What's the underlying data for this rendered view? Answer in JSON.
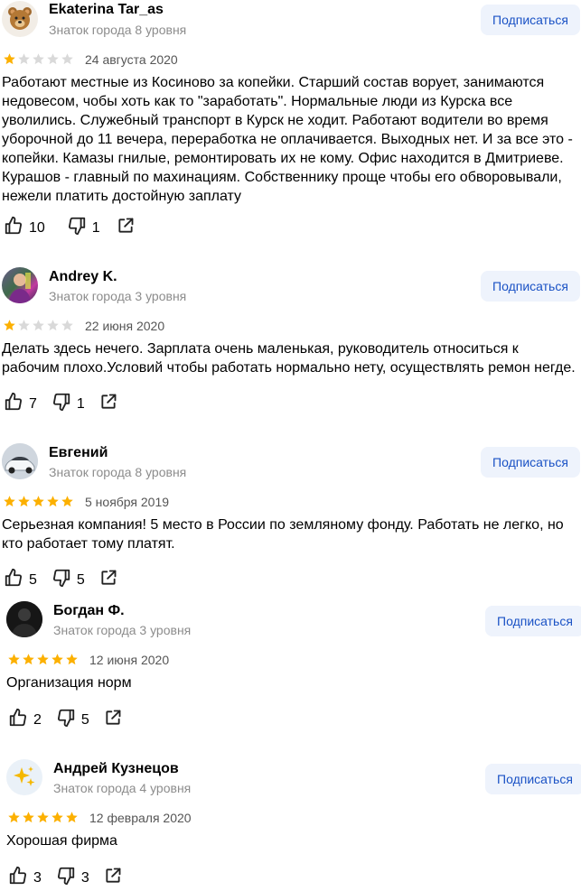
{
  "colors": {
    "star_on": "#fcb000",
    "star_off": "#d9d9d9",
    "subscribe_bg": "#eef3fc",
    "subscribe_text": "#1a52c5"
  },
  "reviews": [
    {
      "author": "Ekaterina Tar_as",
      "level": "Знаток города 8 уровня",
      "subscribe_label": "Подписаться",
      "rating": 1,
      "date": "24 августа 2020",
      "text": "Работают местные из Косиново за копейки. Старший состав ворует, занимаются недовесом, чобы хоть как то \"заработать\". Нормальные люди из Курска все уволились. Служебный транспорт в Курск не ходит. Работают водители во время уборочной до 11 вечера, переработка не оплачивается. Выходных нет. И за все это - копейки. Камазы гнилые, ремонтировать их не кому. Офис находится в Дмитриеве. Курашов - главный по махинациям. Собственнику проще чтобы его обворовывали, нежели платить достойную заплату",
      "likes": "10",
      "dislikes": "1",
      "avatar_icon": "bear-emoji-icon"
    },
    {
      "author": "Andrey K.",
      "level": "Знаток города 3 уровня",
      "subscribe_label": "Подписаться",
      "rating": 1,
      "date": "22 июня 2020",
      "text": "Делать здесь нечего. Зарплата очень маленькая, руководитель относиться к рабочим плохо.Условий чтобы работать нормально нету, осуществлять ремон негде.",
      "likes": "7",
      "dislikes": "1",
      "avatar_icon": "photo-avatar-icon"
    },
    {
      "author": "Евгений",
      "level": "Знаток города 8 уровня",
      "subscribe_label": "Подписаться",
      "rating": 5,
      "date": "5 ноября 2019",
      "text": "Серьезная компания! 5 место в России по земляному фонду. Работать не легко, но кто работает тому платят.",
      "likes": "5",
      "dislikes": "5",
      "avatar_icon": "car-avatar-icon"
    },
    {
      "author": "Богдан Ф.",
      "level": "Знаток города 3 уровня",
      "subscribe_label": "Подписаться",
      "rating": 5,
      "date": "12 июня 2020",
      "text": "Организация норм",
      "likes": "2",
      "dislikes": "5",
      "avatar_icon": "dark-photo-avatar-icon"
    },
    {
      "author": "Андрей Кузнецов",
      "level": "Знаток города 4 уровня",
      "subscribe_label": "Подписаться",
      "rating": 5,
      "date": "12 февраля 2020",
      "text": "Хорошая фирма",
      "likes": "3",
      "dislikes": "3",
      "avatar_icon": "sparkles-emoji-icon"
    }
  ]
}
